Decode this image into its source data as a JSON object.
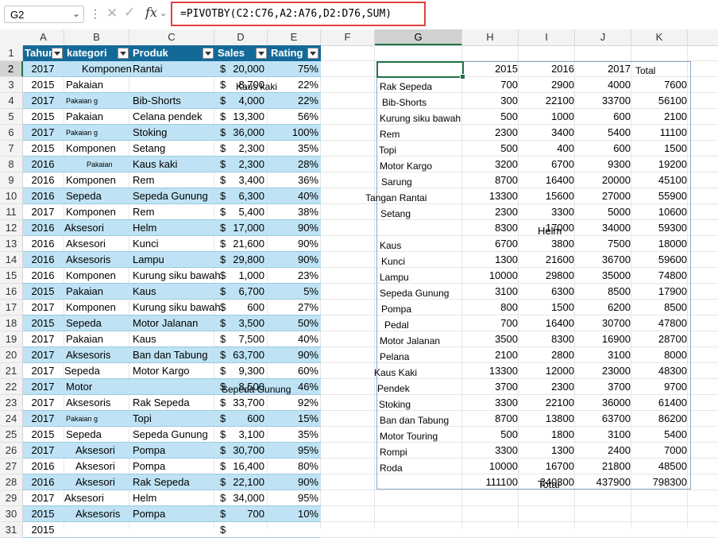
{
  "formula_bar": {
    "name_box": "G2",
    "formula": "=PIVOTBY(C2:C76,A2:A76,D2:D76,SUM)",
    "fx_label": "fx"
  },
  "columns": [
    "A",
    "B",
    "C",
    "D",
    "E",
    "F",
    "G",
    "H",
    "I",
    "J",
    "K"
  ],
  "rows": [
    "1",
    "2",
    "3",
    "4",
    "5",
    "6",
    "7",
    "8",
    "9",
    "10",
    "11",
    "12",
    "13",
    "14",
    "15",
    "16",
    "17",
    "18",
    "19",
    "20",
    "21",
    "22",
    "23",
    "24",
    "25",
    "26",
    "27",
    "28",
    "29",
    "30",
    "31"
  ],
  "table": {
    "headers": [
      "Tahun",
      "kategori",
      "Produk",
      "Sales",
      "Rating"
    ],
    "rows": [
      [
        "2017",
        "Komponen",
        "Rantai",
        "$",
        "20,000",
        "75%"
      ],
      [
        "2015",
        "Pakaian",
        "",
        "$",
        "8,700",
        "22%"
      ],
      [
        "2017",
        "Pakaian  g",
        "Bib-Shorts",
        "$",
        "4,000",
        "22%"
      ],
      [
        "2015",
        "Pakaian",
        "Celana pendek",
        "$",
        "13,300",
        "56%"
      ],
      [
        "2017",
        "Pakaian  g",
        "Stoking",
        "$",
        "36,000",
        "100%"
      ],
      [
        "2015",
        "Komponen",
        "Setang",
        "$",
        "2,300",
        "35%"
      ],
      [
        "2016",
        "Pakaian",
        "Kaus kaki",
        "$",
        "2,300",
        "28%"
      ],
      [
        "2016",
        "Komponen",
        "Rem",
        "$",
        "3,400",
        "36%"
      ],
      [
        "2016",
        "Sepeda",
        "Sepeda Gunung",
        "$",
        "6,300",
        "40%"
      ],
      [
        "2017",
        "Komponen",
        "Rem",
        "$",
        "5,400",
        "38%"
      ],
      [
        "2016",
        "Aksesori",
        "Helm",
        "$",
        "17,000",
        "90%"
      ],
      [
        "2016",
        "Aksesori",
        "Kunci",
        "$",
        "21,600",
        "90%"
      ],
      [
        "2016",
        "Aksesoris",
        "Lampu",
        "$",
        "29,800",
        "90%"
      ],
      [
        "2016",
        "Komponen",
        "Kurung siku bawah",
        "$",
        "1,000",
        "23%"
      ],
      [
        "2015",
        "Pakaian",
        "Kaus",
        "$",
        "6,700",
        "5%"
      ],
      [
        "2017",
        "Komponen",
        "Kurung siku bawah",
        "$",
        "600",
        "27%"
      ],
      [
        "2015",
        "Sepeda",
        "Motor Jalanan",
        "$",
        "3,500",
        "50%"
      ],
      [
        "2017",
        "Pakaian",
        "Kaus",
        "$",
        "7,500",
        "40%"
      ],
      [
        "2017",
        "Aksesoris",
        "Ban dan Tabung",
        "$",
        "63,700",
        "90%"
      ],
      [
        "2017",
        "Sepeda",
        "Motor Kargo",
        "$",
        "9,300",
        "60%"
      ],
      [
        "2017",
        "Motor",
        "",
        "$",
        "8,500",
        "46%"
      ],
      [
        "2017",
        "Aksesoris",
        "Rak Sepeda",
        "$",
        "33,700",
        "92%"
      ],
      [
        "2017",
        "Pakaian  g",
        "Topi",
        "$",
        "600",
        "15%"
      ],
      [
        "2015",
        "Sepeda",
        "Sepeda Gunung",
        "$",
        "3,100",
        "35%"
      ],
      [
        "2017",
        "Aksesori",
        "Pompa",
        "$",
        "30,700",
        "95%"
      ],
      [
        "2016",
        "Aksesori",
        "Pompa",
        "$",
        "16,400",
        "80%"
      ],
      [
        "2016",
        "Aksesori",
        "Rak Sepeda",
        "$",
        "22,100",
        "90%"
      ],
      [
        "2017",
        "Aksesori",
        "Helm",
        "$",
        "34,000",
        "95%"
      ],
      [
        "2015",
        "Aksesoris",
        "Pompa",
        "$",
        "700",
        "10%"
      ],
      [
        "2015",
        "",
        "",
        "$",
        "",
        ""
      ]
    ],
    "overflow_labels": [
      "Kaus kaki",
      "Sepeda Gunung"
    ]
  },
  "pivot": {
    "year_headers": [
      "2015",
      "2016",
      "2017",
      "Total"
    ],
    "rows": [
      [
        "Rak Sepeda",
        "700",
        "2900",
        "4000",
        "7600"
      ],
      [
        "Bib-Shorts",
        "300",
        "22100",
        "33700",
        "56100"
      ],
      [
        "Kurung siku bawah",
        "500",
        "1000",
        "600",
        "2100"
      ],
      [
        "Rem",
        "2300",
        "3400",
        "5400",
        "11100"
      ],
      [
        "Topi",
        "500",
        "400",
        "600",
        "1500"
      ],
      [
        "Motor Kargo",
        "3200",
        "6700",
        "9300",
        "19200"
      ],
      [
        "Sarung",
        "8700",
        "16400",
        "20000",
        "45100"
      ],
      [
        "Tangan Rantai",
        "13300",
        "15600",
        "27000",
        "55900"
      ],
      [
        "Setang",
        "2300",
        "3300",
        "5000",
        "10600"
      ],
      [
        "",
        "8300",
        "17000",
        "34000",
        "59300"
      ],
      [
        "Kaus",
        "6700",
        "3800",
        "7500",
        "18000"
      ],
      [
        "Kunci",
        "1300",
        "21600",
        "36700",
        "59600"
      ],
      [
        "Lampu",
        "10000",
        "29800",
        "35000",
        "74800"
      ],
      [
        "Sepeda Gunung",
        "3100",
        "6300",
        "8500",
        "17900"
      ],
      [
        "Pompa",
        "800",
        "1500",
        "6200",
        "8500"
      ],
      [
        "Pedal",
        "700",
        "16400",
        "30700",
        "47800"
      ],
      [
        "Motor Jalanan",
        "3500",
        "8300",
        "16900",
        "28700"
      ],
      [
        "Pelana",
        "2100",
        "2800",
        "3100",
        "8000"
      ],
      [
        "Kaus Kaki",
        "13300",
        "12000",
        "23000",
        "48300"
      ],
      [
        "Pendek",
        "3700",
        "2300",
        "3700",
        "9700"
      ],
      [
        "Stoking",
        "3300",
        "22100",
        "36000",
        "61400"
      ],
      [
        "Ban dan Tabung",
        "8700",
        "13800",
        "63700",
        "86200"
      ],
      [
        "Motor Touring",
        "500",
        "1800",
        "3100",
        "5400"
      ],
      [
        "Rompi",
        "3300",
        "1300",
        "2400",
        "7000"
      ],
      [
        "Roda",
        "10000",
        "16700",
        "21800",
        "48500"
      ]
    ],
    "totals": [
      "111100",
      "240300",
      "437900",
      "798300"
    ],
    "overflow_labels": [
      "Helm",
      "Total"
    ]
  }
}
